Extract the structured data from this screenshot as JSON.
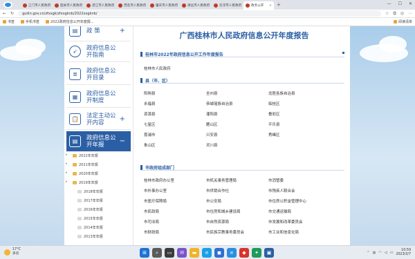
{
  "browser": {
    "tabs": [
      {
        "label": "江门市人民政府"
      },
      {
        "label": "韶关市人民政府"
      },
      {
        "label": "湛江市人民政府"
      },
      {
        "label": "茂名市人民政府"
      },
      {
        "label": "肇庆市人民政府"
      },
      {
        "label": "清远市人民政府"
      },
      {
        "label": "云浮市人民政府"
      },
      {
        "label": "政务公开"
      }
    ],
    "url": "guilin.gov.cn/zfxxgk/zfxxgknb/2022xxgknb/",
    "bookmarks": [
      "书签",
      "手机书签",
      "2022政府信息公开年度报..."
    ],
    "bookmark_right": "阅读清单"
  },
  "sidebar": {
    "items": [
      {
        "label": "政    策",
        "icon": "policy-icon",
        "expandable": "+"
      },
      {
        "label": "政府信息公开指南",
        "icon": "compass-icon"
      },
      {
        "label": "政府信息公开目录",
        "icon": "catalog-icon"
      },
      {
        "label": "政府信息公开制度",
        "icon": "system-icon"
      },
      {
        "label": "法定主动公开内容",
        "icon": "clipboard-icon",
        "expandable": "+"
      },
      {
        "label": "政府信息公开年报",
        "icon": "report-icon",
        "expandable": "−",
        "active": true
      }
    ],
    "years": [
      {
        "label": "2022年年报"
      },
      {
        "label": "2021年年报"
      },
      {
        "label": "2020年年报"
      },
      {
        "label": "2019年年报"
      },
      {
        "label": "2018年年报"
      },
      {
        "label": "2017年年报"
      },
      {
        "label": "2016年年报"
      },
      {
        "label": "2015年年报"
      },
      {
        "label": "2014年年报"
      },
      {
        "label": "2013年年报"
      }
    ]
  },
  "main": {
    "title": "广西桂林市人民政府信息公开年度报告",
    "section_report": "桂林市2022年政府信息公开工作年度报告",
    "municipal": "桂林市人民政府",
    "section_counties": "县（市、区）",
    "counties": [
      [
        "阳朔县",
        "全州县",
        "龙胜各族自治县"
      ],
      [
        "永福县",
        "恭城瑶族自治县",
        "临桂区"
      ],
      [
        "资源县",
        "灌阳县",
        "叠彩区"
      ],
      [
        "七星区",
        "雁山区",
        "平乐县"
      ],
      [
        "荔浦市",
        "兴安县",
        "秀峰区"
      ],
      [
        "象山区",
        "灵川县"
      ]
    ],
    "section_departments": "市政府组成部门",
    "departments": [
      [
        "桂林市政府办公室",
        "市机关事务管理局",
        "市消管委"
      ],
      [
        "市外事办公室",
        "市供销合作社",
        "市残疾人联合会"
      ],
      [
        "市医疗保障局",
        "市公安局",
        "市住房公积金管理中心"
      ],
      [
        "市民政局",
        "市住房和城乡建设局",
        "市交通运输局"
      ],
      [
        "市司法局",
        "市自然资源局",
        "市发展和改革委员会"
      ],
      [
        "市财政局",
        "市民族宗教事务委员会",
        "市工业和信息化局"
      ]
    ]
  },
  "taskbar": {
    "weather_temp": "17°C",
    "weather_desc": "多云",
    "time": "10:59",
    "date": "2023/3/7",
    "ime": "中"
  }
}
